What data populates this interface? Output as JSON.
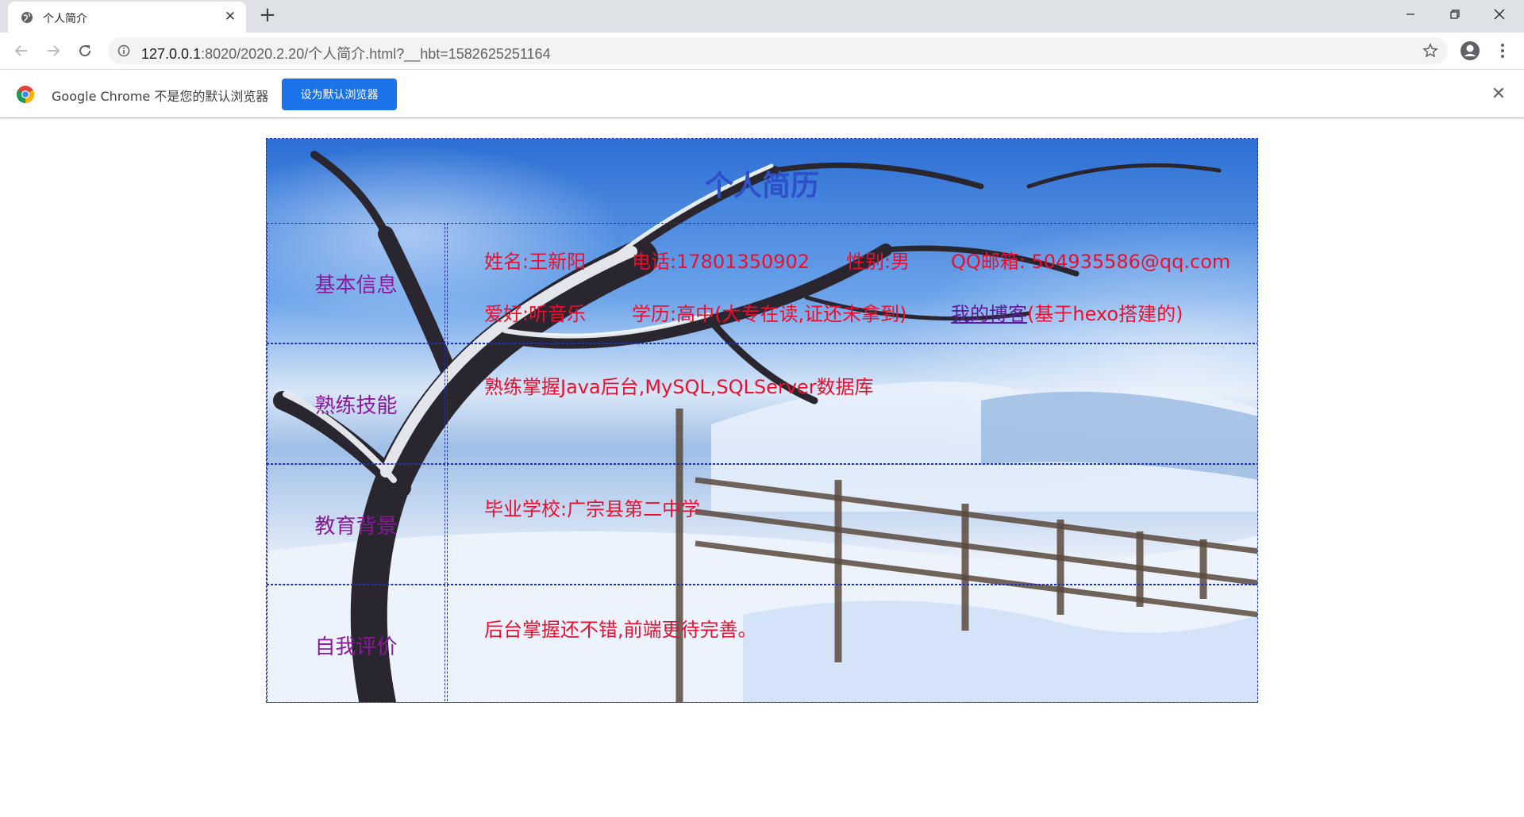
{
  "browser": {
    "tab_title": "个人简介",
    "url_host": "127.0.0.1",
    "url_rest": ":8020/2020.2.20/个人简介.html?__hbt=1582625251164",
    "infobar_text": "Google Chrome 不是您的默认浏览器",
    "infobar_button": "设为默认浏览器"
  },
  "page": {
    "title": "个人简历",
    "sections": {
      "basic": {
        "label": "基本信息",
        "name": "姓名:王新阳",
        "phone": "电话:17801350902",
        "gender": "性别:男",
        "email": "QQ邮箱: 504935586@qq.com",
        "hobby": "爱好:听音乐",
        "education_level": "学历:高中(大专在读,证还未拿到)",
        "blog_link": "我的博客",
        "blog_note": "(基于hexo搭建的)"
      },
      "skills": {
        "label": "熟练技能",
        "text": "熟练掌握Java后台,MySQL,SQLServer数据库"
      },
      "education": {
        "label": "教育背景",
        "text": "毕业学校:广宗县第二中学"
      },
      "self_eval": {
        "label": "自我评价",
        "text": "后台掌握还不错,前端更待完善。"
      }
    }
  },
  "colors": {
    "title": "#2d4fc8",
    "label": "#8a1a9a",
    "body_text": "#e8102e",
    "link": "#5b1a9a",
    "button": "#1a73e8"
  }
}
